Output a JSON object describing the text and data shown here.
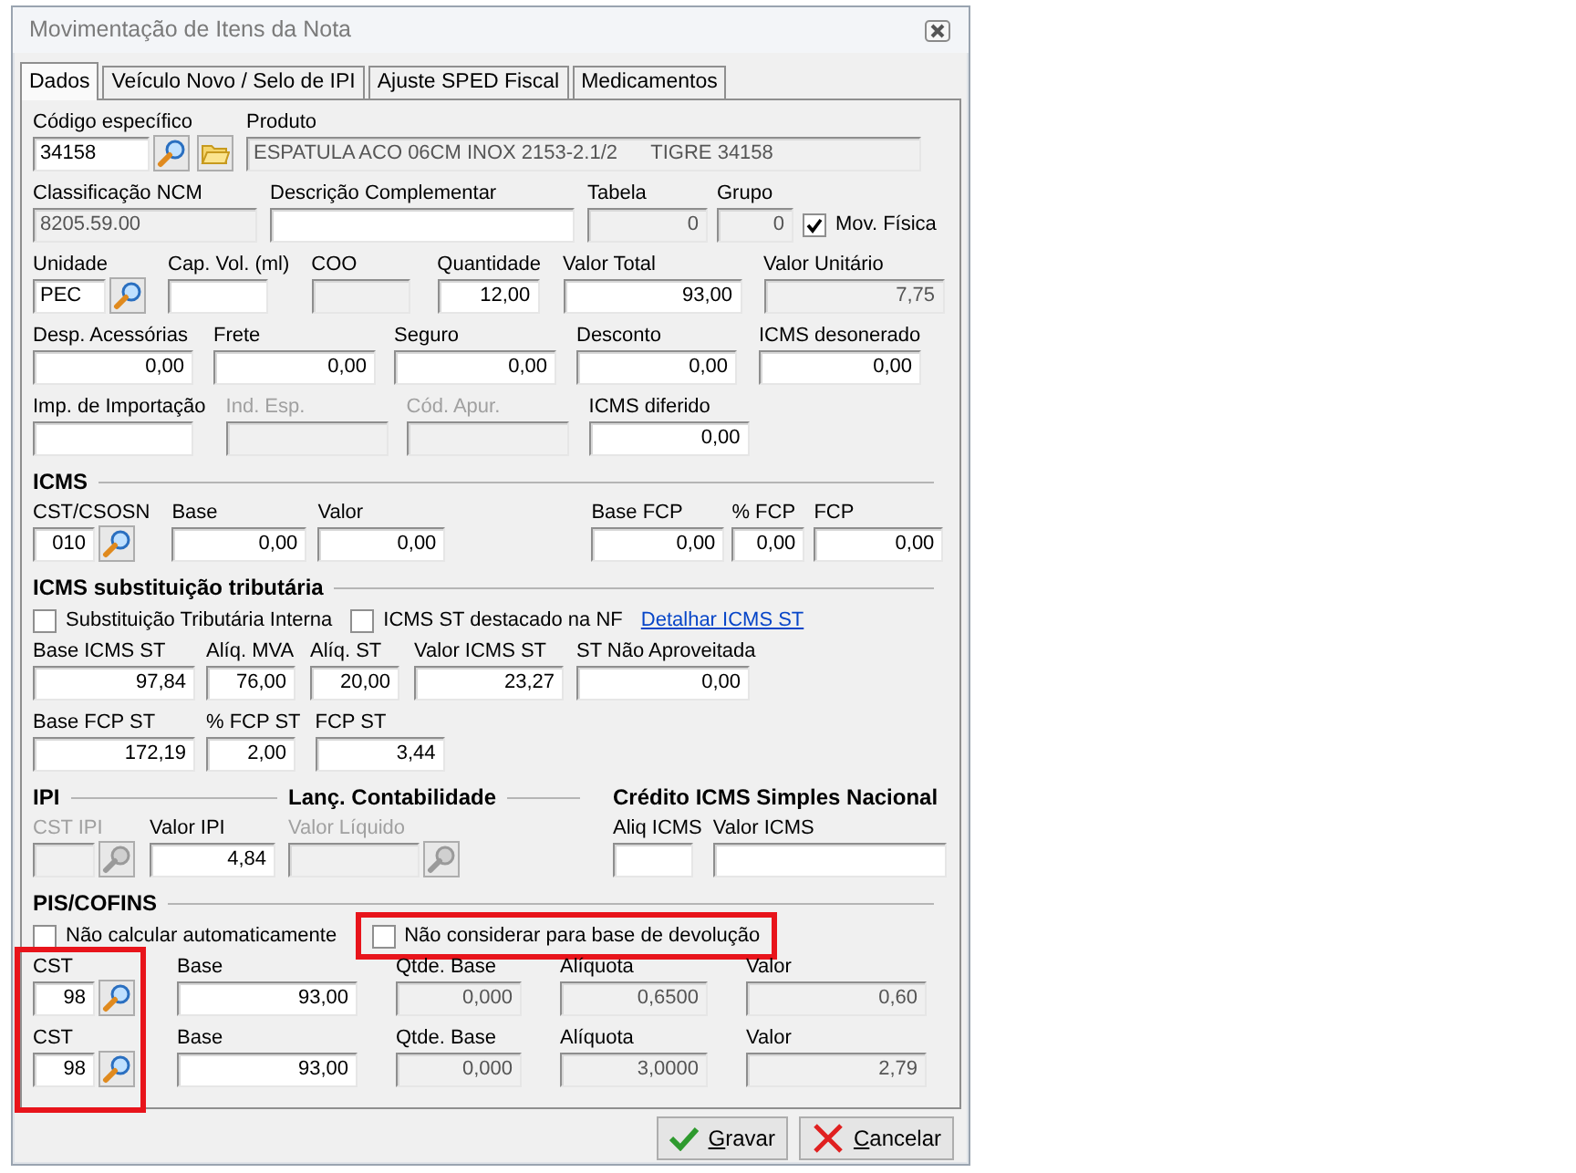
{
  "window": {
    "title": "Movimentação de Itens da Nota"
  },
  "tabs": [
    {
      "label": "Dados",
      "selected": true
    },
    {
      "label": "Veículo Novo / Selo de IPI",
      "selected": false
    },
    {
      "label": "Ajuste SPED Fiscal",
      "selected": false
    },
    {
      "label": "Medicamentos",
      "selected": false
    }
  ],
  "blocks": [
    {
      "kind": "fields",
      "fields": [
        {
          "kind": "text",
          "label": "Código específico",
          "value": "34158",
          "lookup": true,
          "folder": true
        },
        {
          "kind": "text",
          "label": "Produto",
          "value": "ESPATULA ACO 06CM INOX 2153-2.1/2      TIGRE 34158",
          "readonly": true
        }
      ]
    },
    {
      "kind": "fields",
      "fields": [
        {
          "kind": "text",
          "label": "Classificação NCM",
          "value": "8205.59.00",
          "readonly": true
        },
        {
          "kind": "text",
          "label": "Descrição Complementar"
        },
        {
          "kind": "number",
          "label": "Tabela",
          "value": "0",
          "readonly": true
        },
        {
          "kind": "number",
          "label": "Grupo",
          "value": "0",
          "readonly": true
        },
        {
          "kind": "checkbox",
          "label": "Mov. Física",
          "checked": true
        }
      ]
    },
    {
      "kind": "fields",
      "fields": [
        {
          "kind": "text",
          "label": "Unidade",
          "value": "PEC",
          "lookup": true
        },
        {
          "kind": "text",
          "label": "Cap. Vol. (ml)"
        },
        {
          "kind": "text",
          "label": "COO",
          "readonly": true
        },
        {
          "kind": "number",
          "label": "Quantidade",
          "value": "12,00"
        },
        {
          "kind": "number",
          "label": "Valor Total",
          "value": "93,00"
        },
        {
          "kind": "number",
          "label": "Valor Unitário",
          "value": "7,75",
          "readonly": true
        }
      ]
    },
    {
      "kind": "fields",
      "fields": [
        {
          "kind": "number",
          "label": "Desp. Acessórias",
          "value": "0,00"
        },
        {
          "kind": "number",
          "label": "Frete",
          "value": "0,00"
        },
        {
          "kind": "number",
          "label": "Seguro",
          "value": "0,00"
        },
        {
          "kind": "number",
          "label": "Desconto",
          "value": "0,00"
        },
        {
          "kind": "number",
          "label": "ICMS desonerado",
          "value": "0,00"
        }
      ]
    },
    {
      "kind": "fields",
      "fields": [
        {
          "kind": "text",
          "label": "Imp. de Importação"
        },
        {
          "kind": "text",
          "label": "Ind. Esp.",
          "disabled": true
        },
        {
          "kind": "text",
          "label": "Cód. Apur.",
          "disabled": true
        },
        {
          "kind": "number",
          "label": "ICMS diferido",
          "value": "0,00"
        }
      ]
    },
    {
      "kind": "heading",
      "titles": [
        "ICMS"
      ]
    },
    {
      "kind": "fields",
      "fields": [
        {
          "kind": "number",
          "label": "CST/CSOSN",
          "value": "010",
          "lookup": true
        },
        {
          "kind": "number",
          "label": "Base",
          "value": "0,00"
        },
        {
          "kind": "number",
          "label": "Valor",
          "value": "0,00"
        },
        {
          "kind": "number",
          "label": "Base FCP",
          "value": "0,00"
        },
        {
          "kind": "number",
          "label": "% FCP",
          "value": "0,00"
        },
        {
          "kind": "number",
          "label": "FCP",
          "value": "0,00"
        }
      ]
    },
    {
      "kind": "heading",
      "titles": [
        "ICMS substituição tributária"
      ]
    },
    {
      "kind": "checks",
      "items": [
        {
          "kind": "checkbox",
          "label": "Substituição Tributária Interna",
          "checked": false
        },
        {
          "kind": "checkbox",
          "label": "ICMS ST destacado na NF",
          "checked": false
        },
        {
          "kind": "link",
          "label": "Detalhar ICMS ST"
        }
      ]
    },
    {
      "kind": "fields",
      "fields": [
        {
          "kind": "number",
          "label": "Base ICMS ST",
          "value": "97,84"
        },
        {
          "kind": "number",
          "label": "Alíq. MVA",
          "value": "76,00"
        },
        {
          "kind": "number",
          "label": "Alíq. ST",
          "value": "20,00"
        },
        {
          "kind": "number",
          "label": "Valor ICMS ST",
          "value": "23,27"
        },
        {
          "kind": "number",
          "label": "ST Não Aproveitada",
          "value": "0,00"
        }
      ]
    },
    {
      "kind": "fields",
      "fields": [
        {
          "kind": "number",
          "label": "Base FCP ST",
          "value": "172,19"
        },
        {
          "kind": "number",
          "label": "% FCP ST",
          "value": "2,00"
        },
        {
          "kind": "number",
          "label": "FCP ST",
          "value": "3,44"
        }
      ]
    },
    {
      "kind": "heading",
      "titles": [
        "IPI",
        "Lanç. Contabilidade",
        "Crédito ICMS Simples Nacional"
      ]
    },
    {
      "kind": "fields",
      "fields": [
        {
          "kind": "text",
          "label": "CST IPI",
          "disabled": true,
          "lookup": true
        },
        {
          "kind": "number",
          "label": "Valor IPI",
          "value": "4,84"
        },
        {
          "kind": "number",
          "label": "Valor Líquido",
          "disabled": true,
          "lookup": true
        },
        {
          "kind": "number",
          "label": "Aliq ICMS"
        },
        {
          "kind": "number",
          "label": "Valor ICMS"
        }
      ]
    },
    {
      "kind": "heading",
      "titles": [
        "PIS/COFINS"
      ]
    },
    {
      "kind": "checks",
      "items": [
        {
          "kind": "checkbox",
          "label": "Não calcular automaticamente",
          "checked": false
        },
        {
          "kind": "checkbox",
          "label": "Não considerar para base de devolução",
          "checked": false,
          "highlighted": true
        }
      ]
    },
    {
      "kind": "fields",
      "fields": [
        {
          "kind": "number",
          "label": "CST",
          "value": "98",
          "lookup": true,
          "highlighted": true
        },
        {
          "kind": "number",
          "label": "Base",
          "value": "93,00"
        },
        {
          "kind": "number",
          "label": "Qtde. Base",
          "value": "0,000",
          "readonly": true
        },
        {
          "kind": "number",
          "label": "Alíquota",
          "value": "0,6500",
          "readonly": true
        },
        {
          "kind": "number",
          "label": "Valor",
          "value": "0,60",
          "readonly": true
        }
      ]
    },
    {
      "kind": "fields",
      "fields": [
        {
          "kind": "number",
          "label": "CST",
          "value": "98",
          "lookup": true,
          "highlighted": true
        },
        {
          "kind": "number",
          "label": "Base",
          "value": "93,00"
        },
        {
          "kind": "number",
          "label": "Qtde. Base",
          "value": "0,000",
          "readonly": true
        },
        {
          "kind": "number",
          "label": "Alíquota",
          "value": "3,0000",
          "readonly": true
        },
        {
          "kind": "number",
          "label": "Valor",
          "value": "2,79",
          "readonly": true
        }
      ]
    }
  ],
  "buttons": [
    {
      "kind": "save",
      "label": "Gravar",
      "mnemonic": true
    },
    {
      "kind": "cancel",
      "label": "Cancelar",
      "mnemonic": true
    }
  ]
}
